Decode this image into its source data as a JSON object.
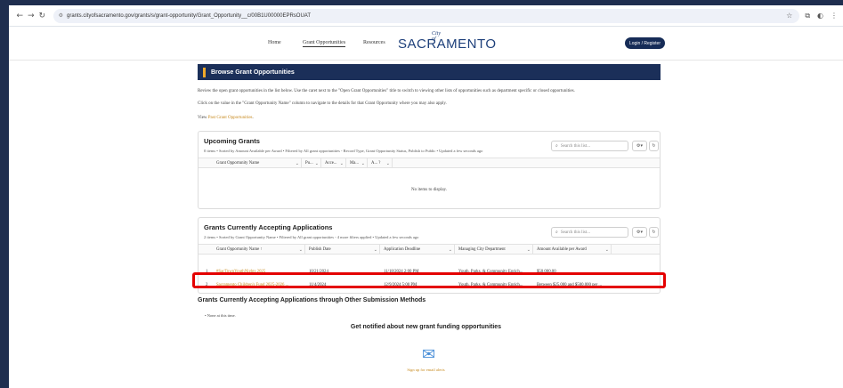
{
  "browser": {
    "url": "grants.cityofsacramento.gov/grants/s/grant-opportunity/Grant_Opportunity__c/00B1U00000EPRsOUAT",
    "icons": {
      "back": "←",
      "forward": "→",
      "reload": "↻",
      "site_info": "⚙",
      "star": "☆",
      "extensions": "⧉",
      "profile": "◐",
      "menu": "⋮"
    }
  },
  "header": {
    "nav": [
      "Home",
      "Grant Opportunities",
      "Resources"
    ],
    "logo_city": "City of",
    "logo_name": "SACRAMENTO",
    "login_label": "Login / Register"
  },
  "banner": {
    "title": "Browse Grant Opportunities"
  },
  "intro": {
    "line1": "Review the open grant opportunities in the list below. Use the caret next to the \"Open Grant Opportunities\" title to switch to viewing other lists of opportunities such as department specific or closed opportunities.",
    "line2": "Click on the value in the \"Grant Opportunity Name\" column to navigate to the details for that Grant Opportunity where you may also apply.",
    "line3_prefix": "View ",
    "line3_link": "Past Grant Opportunities",
    "line3_suffix": "."
  },
  "upcoming": {
    "title": "Upcoming Grants",
    "subtitle": "0 items • Sorted by Amount Available per Award • Filtered by All grant opportunities - Record Type, Grant Opportunity Status, Publish to Public • Updated a few seconds ago",
    "search_placeholder": "Search this list...",
    "columns": [
      "Grant Opportunity Name",
      "Pu...",
      "Acce...",
      "Ma...",
      "A... ?"
    ],
    "empty_text": "No items to display."
  },
  "accepting": {
    "title": "Grants Currently Accepting Applications",
    "subtitle": "2 items • Sorted by Grant Opportunity Name • Filtered by All grant opportunities - 4 more filters applied • Updated a few seconds ago",
    "search_placeholder": "Search this list...",
    "columns": [
      "Grant Opportunity Name ↑",
      "Publish Date",
      "Application Deadline",
      "Managing City Department",
      "Amount Available per Award"
    ],
    "rows": [
      {
        "num": "1",
        "name": "#SacTownYouthNights 2025",
        "publish": "10/21/2024",
        "deadline": "11/18/2024 2:00 PM",
        "dept": "Youth, Parks, & Community Enrich...",
        "amount": "$50,000.00"
      },
      {
        "num": "2",
        "name": "Sacramento Children's Fund 2025-2026 ...",
        "publish": "11/4/2024",
        "deadline": "12/9/2024 5:00 PM",
        "dept": "Youth, Parks, & Community Enrich...",
        "amount": "Between $25,000 and $500,000 per ..."
      }
    ]
  },
  "other": {
    "title": "Grants Currently Accepting Applications through Other Submission Methods",
    "none_text": "• None at this time."
  },
  "notify": {
    "title": "Get notified about new grant funding opportunities",
    "signup": "Sign up for email alerts"
  },
  "colors": {
    "navy": "#1b2f59",
    "accent": "#f0a92a",
    "link": "#c7891d",
    "highlight": "#e40000"
  }
}
